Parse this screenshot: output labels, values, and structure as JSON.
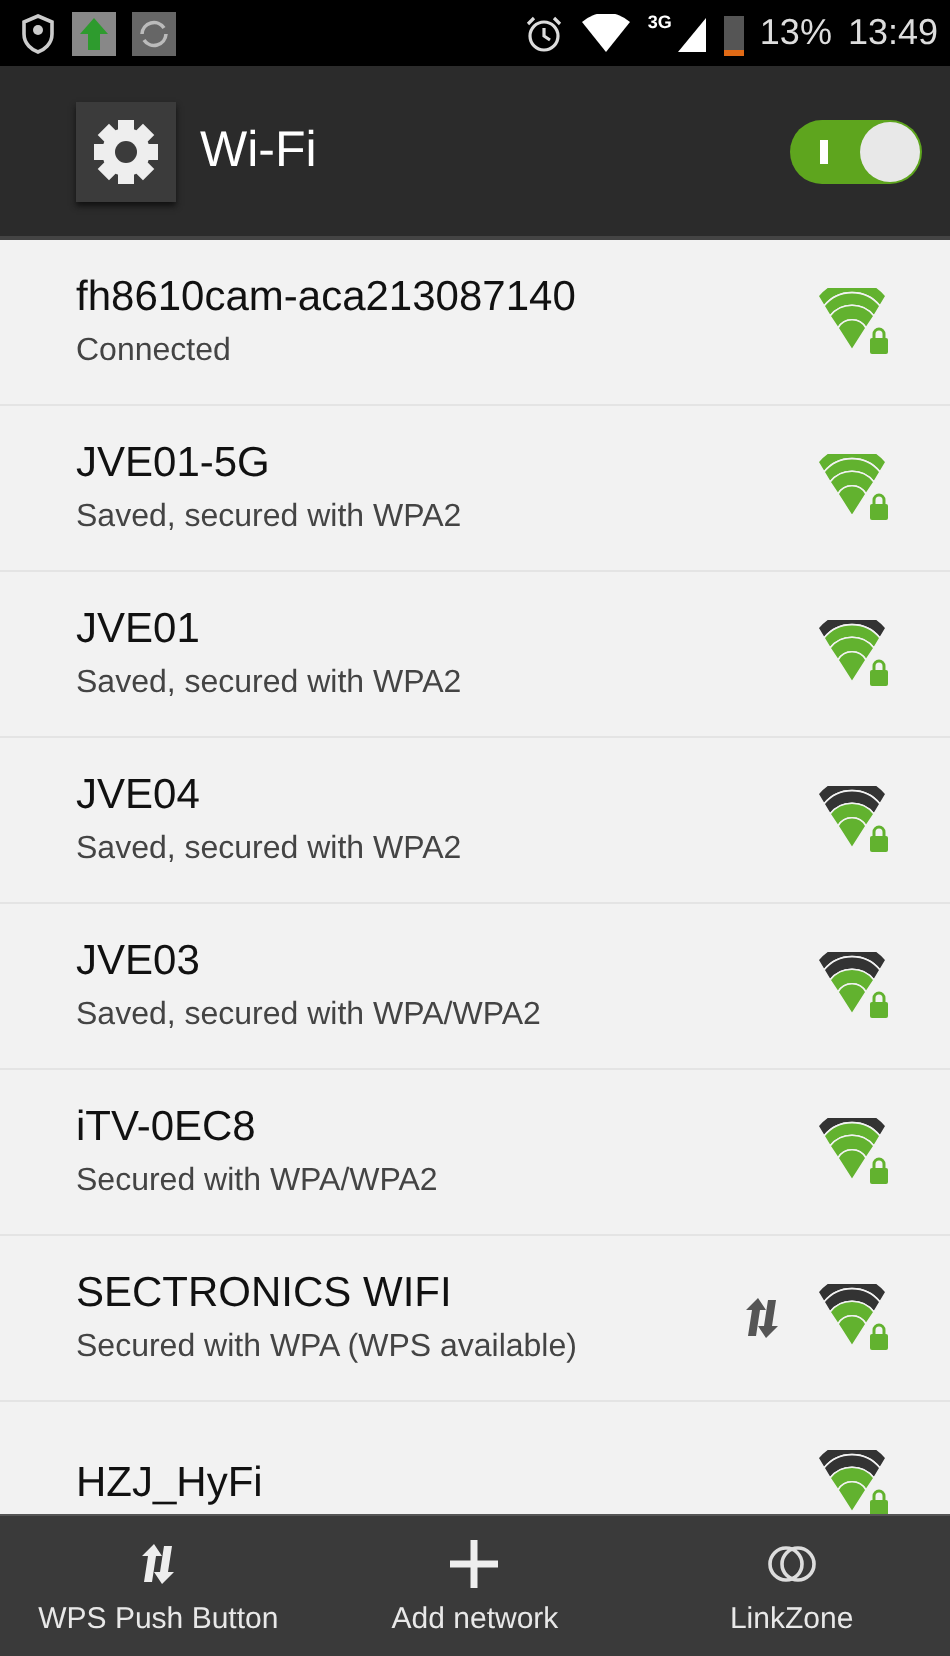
{
  "status_bar": {
    "network_type": "3G",
    "battery": "13%",
    "time": "13:49"
  },
  "header": {
    "title": "Wi-Fi",
    "wifi_on": true
  },
  "networks": [
    {
      "name": "fh8610cam-aca213087140",
      "status": "Connected",
      "kind": "strong",
      "wps": false
    },
    {
      "name": "JVE01-5G",
      "status": "Saved, secured with WPA2",
      "kind": "strong",
      "wps": false
    },
    {
      "name": "JVE01",
      "status": "Saved, secured with WPA2",
      "kind": "good",
      "wps": false
    },
    {
      "name": "JVE04",
      "status": "Saved, secured with WPA2",
      "kind": "fair",
      "wps": false
    },
    {
      "name": "JVE03",
      "status": "Saved, secured with WPA/WPA2",
      "kind": "fair",
      "wps": false
    },
    {
      "name": "iTV-0EC8",
      "status": "Secured with WPA/WPA2",
      "kind": "good",
      "wps": false
    },
    {
      "name": "SECTRONICS WIFI",
      "status": "Secured with WPA (WPS available)",
      "kind": "fair",
      "wps": true
    },
    {
      "name": "HZJ_HyFi",
      "kind": "fair",
      "wps": false
    }
  ],
  "actions": [
    {
      "kind": "wps",
      "label": "WPS Push Button"
    },
    {
      "kind": "add",
      "label": "Add network"
    },
    {
      "kind": "link",
      "label": "LinkZone"
    }
  ]
}
